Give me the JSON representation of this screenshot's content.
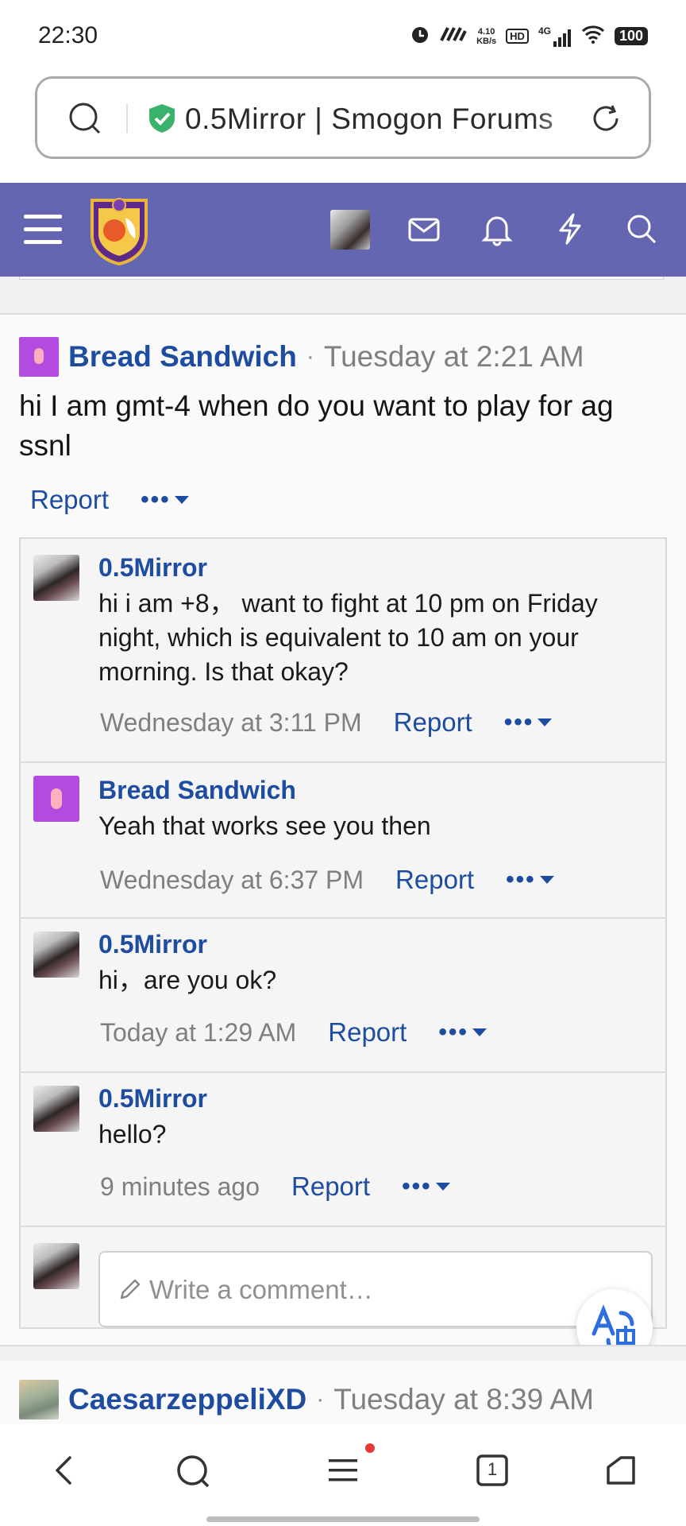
{
  "status_bar": {
    "time": "22:30",
    "speed_value": "4.10",
    "speed_unit": "KB/s",
    "hd": "HD",
    "network": "4G",
    "battery": "100",
    "icons": [
      "alarm-icon",
      "nfc-icon",
      "signal-icon",
      "wifi-icon",
      "battery-icon"
    ]
  },
  "address_bar": {
    "url_text": "0.5Mirror | Smogon Forums",
    "secure_icon": "shield-check-icon",
    "accent_color": "#3bb26c"
  },
  "site_header": {
    "bg_color": "#6466b1",
    "icons": [
      "menu-icon",
      "smogon-logo",
      "user-avatar",
      "mail-icon",
      "bell-icon",
      "bolt-icon",
      "search-icon"
    ]
  },
  "post": {
    "author": "Bread Sandwich",
    "separator": "·",
    "time": "Tuesday at 2:21 AM",
    "body": "hi I am gmt-4 when do you want to play for ag ssnl",
    "report_label": "Report",
    "more_label": "•••"
  },
  "comments": [
    {
      "author": "0.5Mirror",
      "text": "hi i am +8， want to fight at 10 pm on Friday night, which is equivalent to 10 am on your morning. Is that okay?",
      "time": "Wednesday at 3:11 PM",
      "report_label": "Report",
      "more_label": "•••"
    },
    {
      "author": "Bread Sandwich",
      "text": "Yeah that works see you then",
      "time": "Wednesday at 6:37 PM",
      "report_label": "Report",
      "more_label": "•••"
    },
    {
      "author": "0.5Mirror",
      "text": "hi，are you ok?",
      "time": "Today at 1:29 AM",
      "report_label": "Report",
      "more_label": "•••"
    },
    {
      "author": "0.5Mirror",
      "text": "hello?",
      "time": "9 minutes ago",
      "report_label": "Report",
      "more_label": "•••"
    }
  ],
  "write_comment": {
    "placeholder": "Write a comment…"
  },
  "next_post": {
    "author": "CaesarzeppeliXD",
    "separator": "·",
    "time": "Tuesday at 8:39 AM"
  },
  "bottom_nav": {
    "tab_count": "1",
    "icons": [
      "back-icon",
      "search-icon",
      "menu-icon",
      "tabs-icon",
      "home-icon"
    ]
  },
  "colors": {
    "link": "#1d4ca0",
    "muted": "#7f7f7f"
  }
}
